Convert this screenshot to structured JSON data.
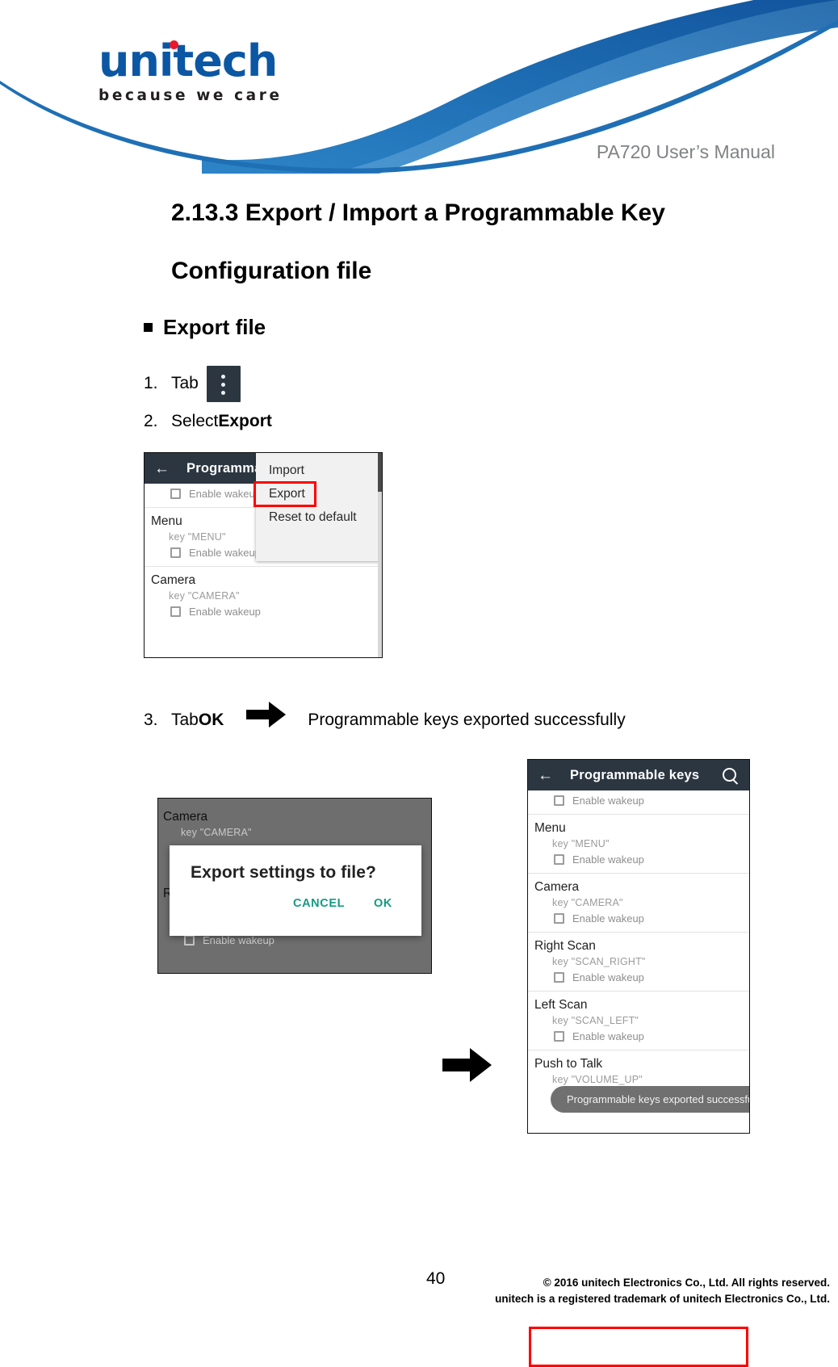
{
  "header": {
    "logo_word": "unitech",
    "logo_tagline": "because we care",
    "manual_title": "PA720 User’s Manual"
  },
  "document": {
    "section_title": "2.13.3 Export / Import a Programmable Key Configuration file",
    "bullet_heading": "Export file",
    "steps": [
      {
        "num": "1.",
        "text": "Tab",
        "icon": "overflow-menu-icon"
      },
      {
        "num": "2.",
        "text": "Select ",
        "bold": "Export"
      },
      {
        "num": "3.",
        "text": "Tab ",
        "bold": "OK",
        "arrow": "right-arrow-icon",
        "tail": "Programmable keys exported successfully"
      }
    ]
  },
  "screenshot_menu": {
    "appbar": {
      "back_icon": "back-arrow-icon",
      "title": "Programmable keys"
    },
    "top_row": {
      "label": "Enable wakeup",
      "checked": false
    },
    "groups": [
      {
        "name": "Menu",
        "key": "key \"MENU\"",
        "wakeup_label": "Enable wakeup",
        "checked": false
      },
      {
        "name": "Camera",
        "key": "key \"CAMERA\"",
        "wakeup_label": "Enable wakeup",
        "checked": false
      }
    ],
    "popup": {
      "items": [
        "Import",
        "Export",
        "Reset to default"
      ],
      "highlighted": "Export",
      "highlight_color": "#FF0000"
    }
  },
  "screenshot_dialog": {
    "background_groups": [
      {
        "name": "Camera",
        "key": "key \"CAMERA\""
      },
      {
        "name": "Ri",
        "key": ""
      }
    ],
    "bottom_wakeup": "Enable wakeup",
    "dialog": {
      "title": "Export settings to file?",
      "cancel_label": "CANCEL",
      "ok_label": "OK",
      "action_color": "#159B82"
    }
  },
  "screenshot_result": {
    "appbar": {
      "back_icon": "back-arrow-icon",
      "title": "Programmable keys",
      "search_icon": "search-icon"
    },
    "top_row": {
      "label": "Enable wakeup",
      "checked": false
    },
    "groups": [
      {
        "name": "Menu",
        "key": "key \"MENU\"",
        "wakeup_label": "Enable wakeup",
        "checked": false
      },
      {
        "name": "Camera",
        "key": "key \"CAMERA\"",
        "wakeup_label": "Enable wakeup",
        "checked": false
      },
      {
        "name": "Right Scan",
        "key": "key \"SCAN_RIGHT\"",
        "wakeup_label": "Enable wakeup",
        "checked": false
      },
      {
        "name": "Left Scan",
        "key": "key \"SCAN_LEFT\"",
        "wakeup_label": "Enable wakeup",
        "checked": false
      },
      {
        "name": "Push to Talk",
        "key": "key \"VOLUME_UP\"",
        "wakeup_label": "",
        "checked": false
      }
    ],
    "toast": "Programmable keys exported successfully",
    "highlight_color": "#FF0000"
  },
  "footer": {
    "page_number": "40",
    "copyright_line1": "© 2016 unitech Electronics Co., Ltd. All rights reserved.",
    "copyright_line2": "unitech is a registered trademark of unitech Electronics Co., Ltd."
  }
}
